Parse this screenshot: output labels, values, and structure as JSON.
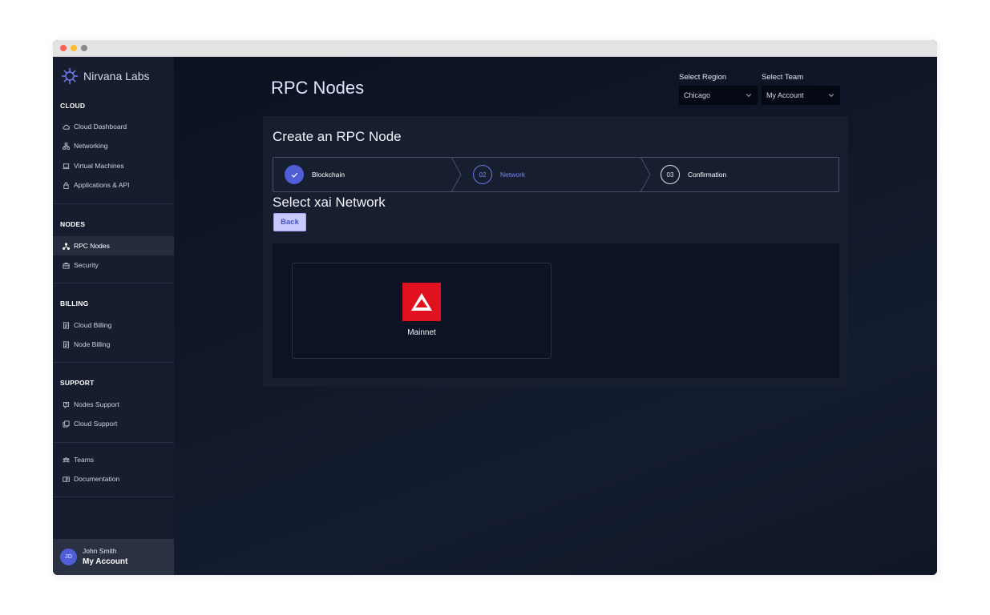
{
  "app": {
    "brand": "Nirvana Labs",
    "colors": {
      "accent": "#4f5dd6",
      "panel": "#161e30",
      "sidebar": "#151d2e",
      "network_logo": "#e1121f"
    }
  },
  "sidebar": {
    "sections": [
      {
        "title": "CLOUD",
        "items": [
          {
            "label": "Cloud Dashboard",
            "icon": "cloud-icon"
          },
          {
            "label": "Networking",
            "icon": "network-icon"
          },
          {
            "label": "Virtual Machines",
            "icon": "laptop-icon"
          },
          {
            "label": "Applications & API",
            "icon": "lock-icon"
          }
        ]
      },
      {
        "title": "NODES",
        "items": [
          {
            "label": "RPC Nodes",
            "icon": "nodes-icon",
            "active": true
          },
          {
            "label": "Security",
            "icon": "briefcase-icon"
          }
        ]
      },
      {
        "title": "BILLING",
        "items": [
          {
            "label": "Cloud Billing",
            "icon": "receipt-icon"
          },
          {
            "label": "Node Billing",
            "icon": "receipt-icon"
          }
        ]
      },
      {
        "title": "SUPPORT",
        "items": [
          {
            "label": "Nodes Support",
            "icon": "support-icon"
          },
          {
            "label": "Cloud Support",
            "icon": "copy-icon"
          }
        ]
      },
      {
        "title": "",
        "items": [
          {
            "label": "Teams",
            "icon": "team-icon"
          },
          {
            "label": "Documentation",
            "icon": "docs-icon"
          }
        ]
      }
    ],
    "account": {
      "initials": "JO",
      "name": "John Smith",
      "subtitle": "My Account"
    }
  },
  "header": {
    "title": "RPC Nodes",
    "region": {
      "label": "Select Region",
      "value": "Chicago"
    },
    "team": {
      "label": "Select Team",
      "value": "My Account"
    }
  },
  "wizard": {
    "title": "Create an RPC Node",
    "steps": [
      {
        "number": "",
        "label": "Blockchain",
        "status": "done"
      },
      {
        "number": "02",
        "label": "Network",
        "status": "current"
      },
      {
        "number": "03",
        "label": "Confirmation",
        "status": "upcoming"
      }
    ],
    "section_heading": "Select xai Network",
    "back_label": "Back",
    "networks": [
      {
        "label": "Mainnet",
        "icon": "xai-logo-icon"
      }
    ]
  }
}
